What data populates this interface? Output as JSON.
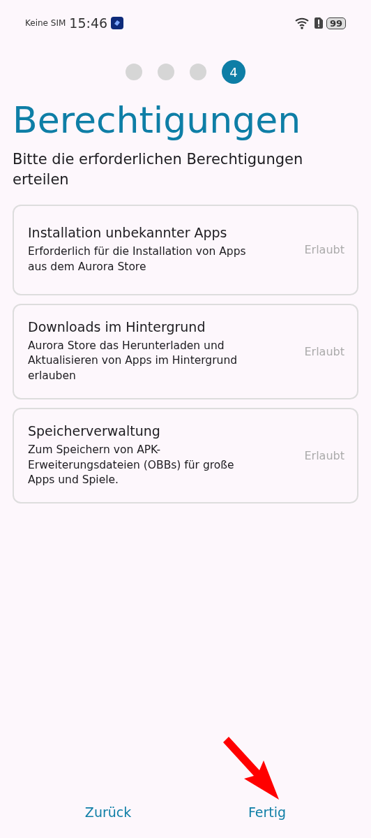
{
  "status_bar": {
    "carrier": "Keine SIM",
    "time": "15:46",
    "battery": "99"
  },
  "steps": [
    {
      "selected": false
    },
    {
      "selected": false
    },
    {
      "selected": false
    },
    {
      "label": "4",
      "selected": true
    }
  ],
  "title": "Berechtigungen",
  "subtitle": "Bitte die erforderlichen Berechtigungen erteilen",
  "permissions": [
    {
      "title": "Installation unbekannter Apps",
      "description": "Erforderlich für die Installation von Apps aus dem Aurora Store",
      "status": "Erlaubt",
      "granted": true
    },
    {
      "title": "Downloads im Hintergrund",
      "description": "Aurora Store das Herunterladen und Aktualisieren von Apps im Hintergrund erlauben",
      "status": "Erlaubt",
      "granted": true
    },
    {
      "title": "Speicherverwaltung",
      "description": "Zum Speichern von APK-Erweiterungsdateien (OBBs) für große Apps und Spiele.",
      "status": "Erlaubt",
      "granted": true
    }
  ],
  "buttons": {
    "back": "Zurück",
    "done": "Fertig"
  },
  "annotation": {
    "kind": "arrow"
  }
}
